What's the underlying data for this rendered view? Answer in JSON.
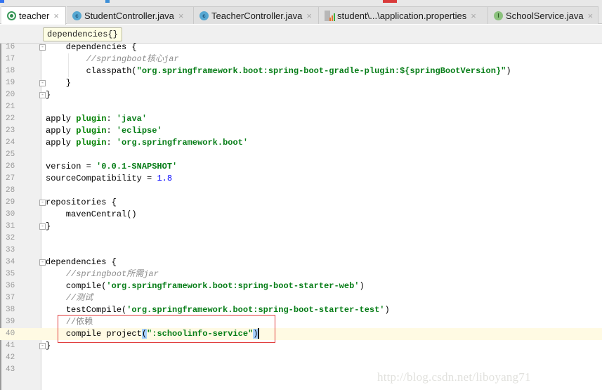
{
  "tabs": [
    {
      "label": "teacher",
      "icon": "gradle-icon",
      "active": true
    },
    {
      "label": "StudentController.java",
      "icon": "class-icon",
      "icon_letter": "c",
      "active": false
    },
    {
      "label": "TeacherController.java",
      "icon": "class-icon",
      "icon_letter": "c",
      "active": false
    },
    {
      "label": "student\\...\\application.properties",
      "icon": "properties-file-icon",
      "active": false
    },
    {
      "label": "SchoolService.java",
      "icon": "interface-icon",
      "icon_letter": "I",
      "active": false
    }
  ],
  "close_glyph": "×",
  "breadcrumb": "dependencies{}",
  "lines": [
    {
      "n": "16"
    },
    {
      "n": "17"
    },
    {
      "n": "18"
    },
    {
      "n": "19"
    },
    {
      "n": "20"
    },
    {
      "n": "21"
    },
    {
      "n": "22"
    },
    {
      "n": "23"
    },
    {
      "n": "24"
    },
    {
      "n": "25"
    },
    {
      "n": "26"
    },
    {
      "n": "27"
    },
    {
      "n": "28"
    },
    {
      "n": "29"
    },
    {
      "n": "30"
    },
    {
      "n": "31"
    },
    {
      "n": "32"
    },
    {
      "n": "33"
    },
    {
      "n": "34"
    },
    {
      "n": "35"
    },
    {
      "n": "36"
    },
    {
      "n": "37"
    },
    {
      "n": "38"
    },
    {
      "n": "39"
    },
    {
      "n": "40"
    },
    {
      "n": "41"
    },
    {
      "n": "42"
    },
    {
      "n": "43"
    }
  ],
  "code": {
    "l16": "    dependencies {",
    "l17_comment": "//springboot核心jar",
    "l18_pre": "classpath(",
    "l18_str": "\"org.springframework.boot:spring-boot-gradle-plugin:${springBootVersion}\"",
    "l18_post": ")",
    "l19": "    }",
    "l20": "}",
    "l22_a": "apply ",
    "l22_b": "plugin",
    "l22_c": ": ",
    "l22_str": "'java'",
    "l23_str": "'eclipse'",
    "l24_str": "'org.springframework.boot'",
    "l26_pre": "version = ",
    "l26_str": "'0.0.1-SNAPSHOT'",
    "l27_pre": "sourceCompatibility = ",
    "l27_num": "1.8",
    "l29": "repositories {",
    "l30": "    mavenCentral()",
    "l31": "}",
    "l34": "dependencies {",
    "l35_comment": "//springboot所需jar",
    "l36_pre": "compile(",
    "l36_str": "'org.springframework.boot:spring-boot-starter-web'",
    "l36_post": ")",
    "l37_comment": "//测试",
    "l38_pre": "testCompile(",
    "l38_str": "'org.springframework.boot:spring-boot-starter-test'",
    "l38_post": ")",
    "l39_comment": "//依赖",
    "l40_pre": "compile project",
    "l40_open": "(",
    "l40_str": "\":schoolinfo-service\"",
    "l40_close": ")",
    "l41": "}"
  },
  "watermark": "http://blog.csdn.net/liboyang71"
}
